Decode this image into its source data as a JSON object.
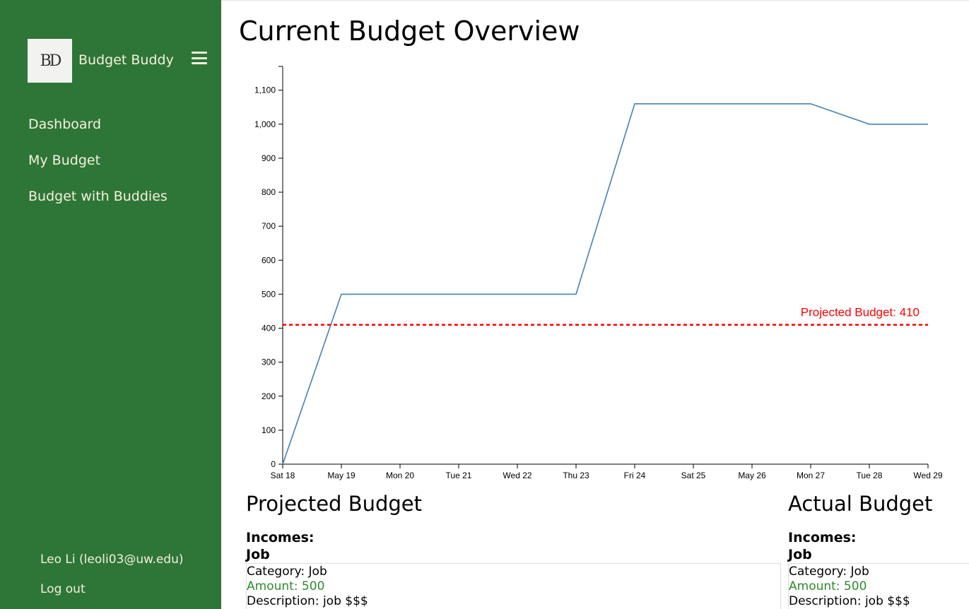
{
  "sidebar": {
    "logo_text": "BD",
    "brand": "Budget Buddy",
    "menu_icon": "hamburger-menu-icon",
    "nav": [
      {
        "label": "Dashboard"
      },
      {
        "label": "My Budget"
      },
      {
        "label": "Budget with Buddies"
      }
    ],
    "user": "Leo Li (leoli03@uw.edu)",
    "logout": "Log out",
    "bg_color": "#2e7538"
  },
  "main": {
    "title": "Current Budget Overview"
  },
  "chart_data": {
    "type": "line",
    "title": "",
    "xlabel": "",
    "ylabel": "",
    "x": [
      "Sat 18",
      "May 19",
      "Mon 20",
      "Tue 21",
      "Wed 22",
      "Thu 23",
      "Fri 24",
      "Sat 25",
      "May 26",
      "Mon 27",
      "Tue 28",
      "Wed 29"
    ],
    "series": [
      {
        "values": [
          0,
          500,
          500,
          500,
          500,
          500,
          1060,
          1060,
          1060,
          1060,
          1000,
          1000
        ],
        "color": "#4682b4"
      }
    ],
    "yticks": [
      "0",
      "100",
      "200",
      "300",
      "400",
      "500",
      "600",
      "700",
      "800",
      "900",
      "1,000",
      "1,100"
    ],
    "ylim": [
      0,
      1170
    ],
    "grid": false,
    "reference_line": {
      "label": "Projected Budget: 410",
      "value": 410,
      "color": "#ff0000",
      "style": "dashed"
    }
  },
  "projected": {
    "title": "Projected Budget",
    "incomes_label": "Incomes:",
    "item_name": "Job",
    "category": "Category: Job",
    "amount": "Amount: 500",
    "description": "Description: job $$$"
  },
  "actual": {
    "title": "Actual Budget",
    "incomes_label": "Incomes:",
    "item_name": "Job",
    "category": "Category: Job",
    "amount": "Amount: 500",
    "description": "Description: job $$$"
  }
}
